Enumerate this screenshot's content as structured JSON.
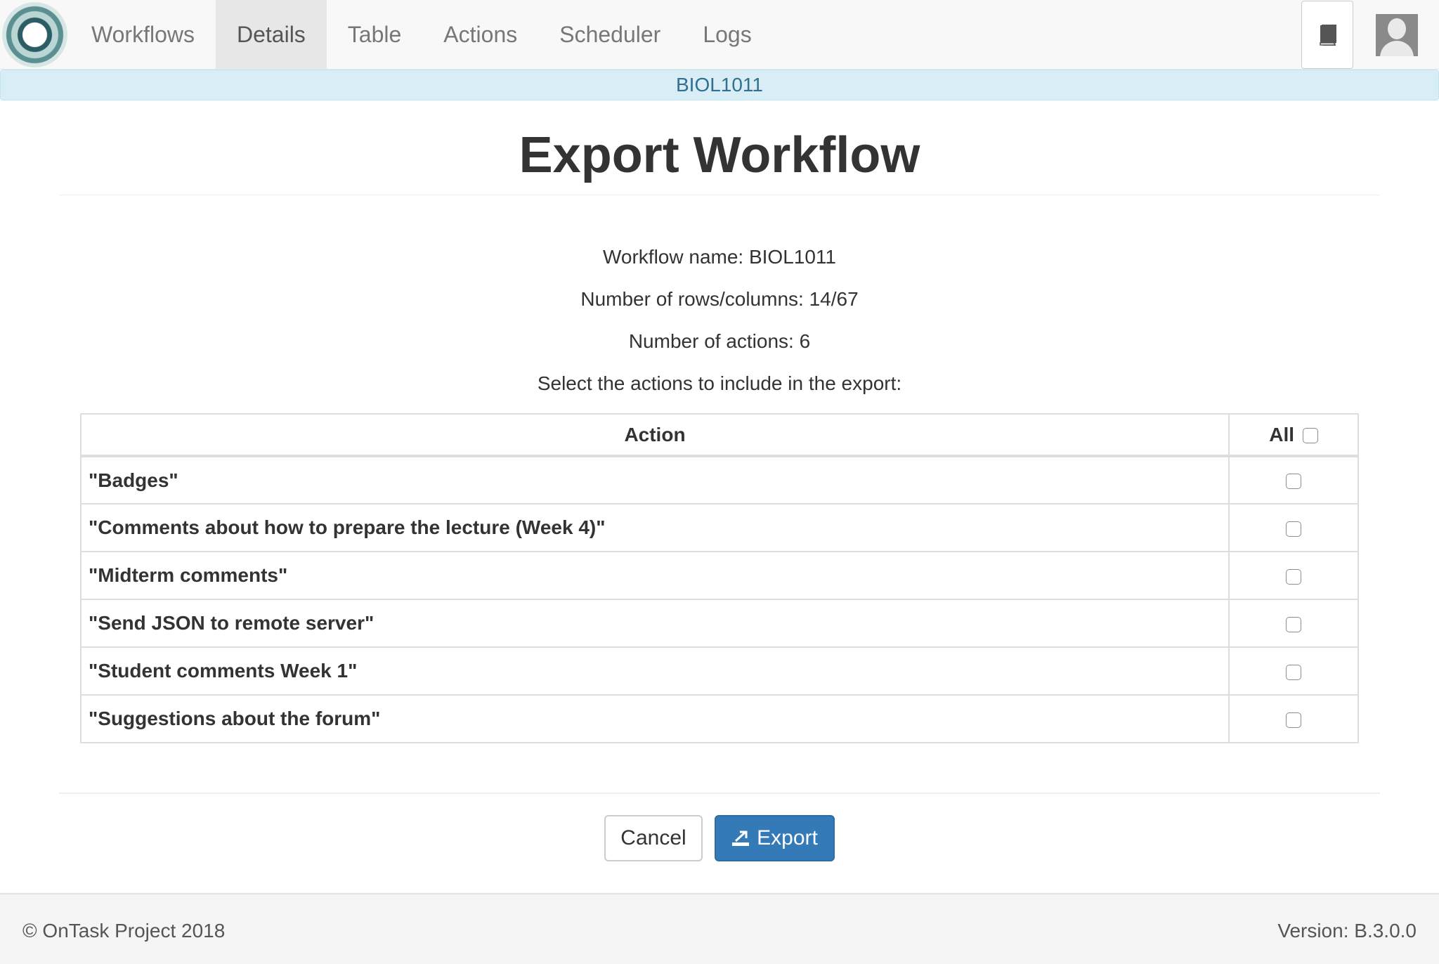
{
  "nav": {
    "tabs": [
      {
        "label": "Workflows"
      },
      {
        "label": "Details"
      },
      {
        "label": "Table"
      },
      {
        "label": "Actions"
      },
      {
        "label": "Scheduler"
      },
      {
        "label": "Logs"
      }
    ],
    "active_tab": "Details"
  },
  "workflow_banner": "BIOL1011",
  "page_title": "Export Workflow",
  "info": {
    "workflow_name": "Workflow name: BIOL1011",
    "rows_columns": "Number of rows/columns: 14/67",
    "num_actions": "Number of actions: 6",
    "select_prompt": "Select the actions to include in the export:"
  },
  "table": {
    "header_action": "Action",
    "header_all": "All",
    "rows": [
      {
        "name": "\"Badges\""
      },
      {
        "name": "\"Comments about how to prepare the lecture (Week 4)\""
      },
      {
        "name": "\"Midterm comments\""
      },
      {
        "name": "\"Send JSON to remote server\""
      },
      {
        "name": "\"Student comments Week 1\""
      },
      {
        "name": "\"Suggestions about the forum\""
      }
    ]
  },
  "buttons": {
    "cancel": "Cancel",
    "export": "Export"
  },
  "footer": {
    "copyright": "© OnTask Project 2018",
    "version": "Version: B.3.0.0"
  },
  "colors": {
    "primary": "#337ab7",
    "banner_bg": "#d9edf7",
    "banner_text": "#31708f",
    "navbar_bg": "#f8f8f8"
  }
}
